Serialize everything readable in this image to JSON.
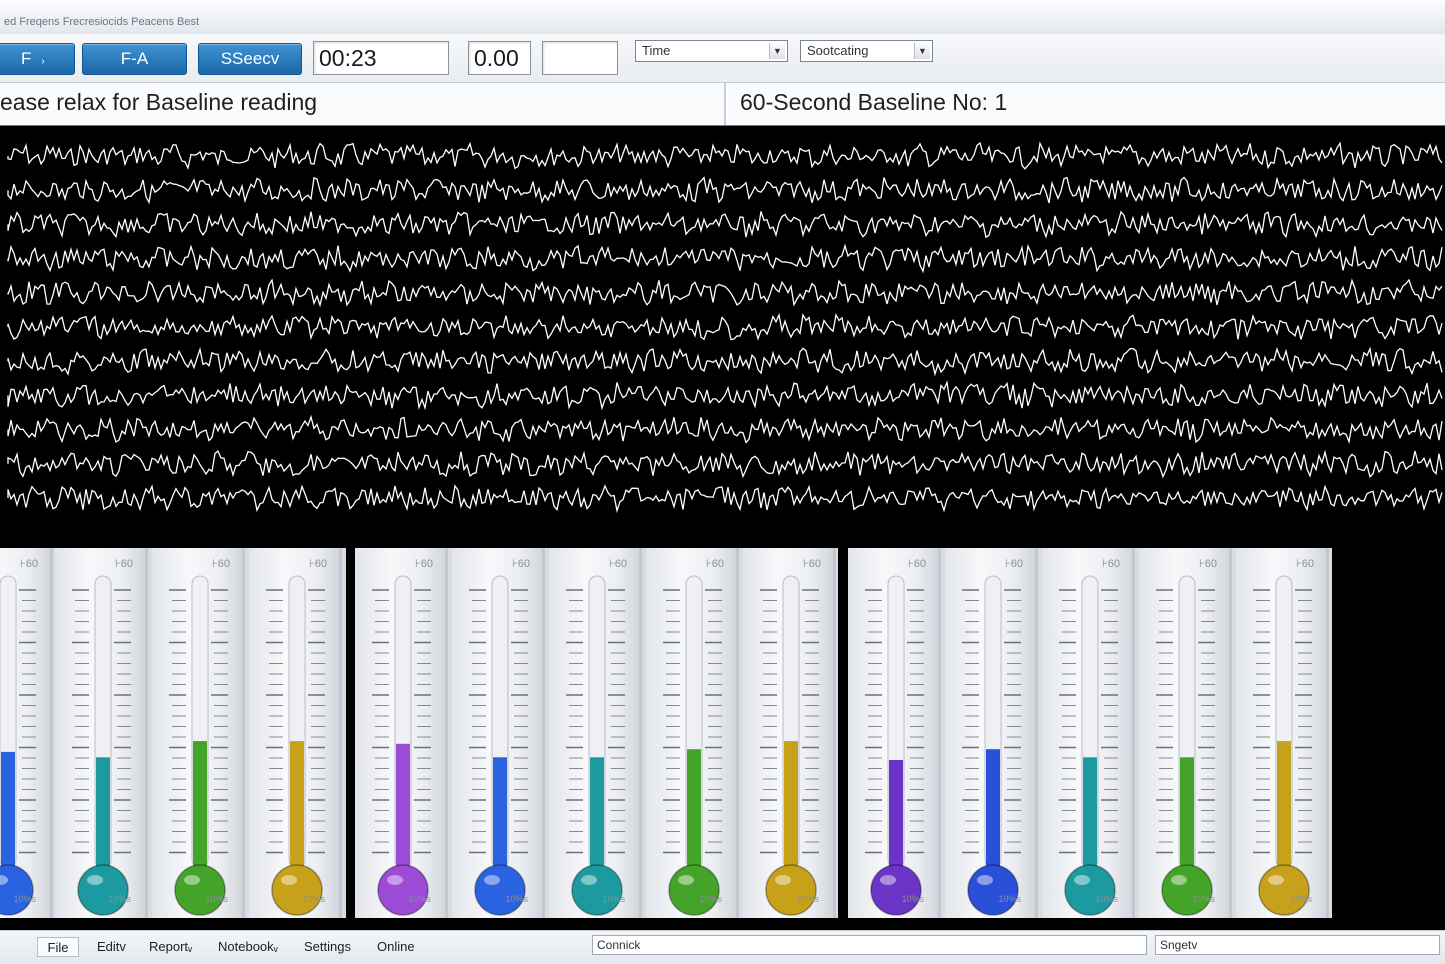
{
  "window": {
    "title": "ed Freqens Frecresiocids Peacens Best"
  },
  "toolbar": {
    "btn_f": "F",
    "btn_fa": "F-A",
    "btn_session": "SSeecv",
    "timer": "00:23",
    "value": "0.00",
    "blank": "",
    "combo_time": "Time",
    "combo_scoring": "Sootcating"
  },
  "message": {
    "instruction": "ease relax for Baseline reading",
    "baseline": "60-Second Baseline No: 1"
  },
  "thermometers": {
    "scale_label": "⊦60",
    "unit_label": "10%s",
    "items": [
      {
        "color": "#2a63e0",
        "level": 0.43
      },
      {
        "color": "#1d9aa0",
        "level": 0.41
      },
      {
        "color": "#44a42a",
        "level": 0.47
      },
      {
        "color": "#c8a11b",
        "level": 0.47
      },
      {
        "color": "#9b4bd6",
        "level": 0.46
      },
      {
        "color": "#2a63e0",
        "level": 0.41
      },
      {
        "color": "#1d9aa0",
        "level": 0.41
      },
      {
        "color": "#44a42a",
        "level": 0.44
      },
      {
        "color": "#c8a11b",
        "level": 0.47
      },
      {
        "color": "#6a34c6",
        "level": 0.4
      },
      {
        "color": "#2a4fd8",
        "level": 0.44
      },
      {
        "color": "#1d9aa0",
        "level": 0.41
      },
      {
        "color": "#44a42a",
        "level": 0.41
      },
      {
        "color": "#c8a11b",
        "level": 0.47
      }
    ]
  },
  "statusbar": {
    "menu_file": "File",
    "menu_edit": "Editv",
    "menu_report": "Reportᵥ",
    "menu_notebook": "Notebookᵥ",
    "menu_settings": "Settings",
    "menu_online": "Online",
    "connect": "Connick",
    "signal": "Sngetv"
  },
  "colors": {
    "accent_button": "#1f6fb2",
    "eeg_background": "#000000",
    "eeg_trace": "#ffffff"
  }
}
